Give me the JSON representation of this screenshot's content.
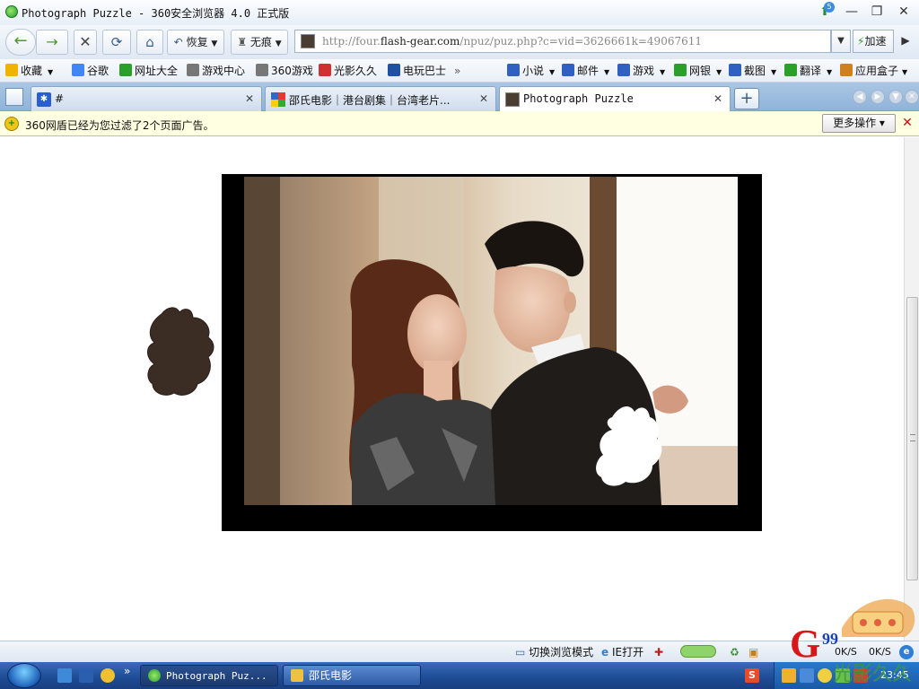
{
  "window": {
    "title": "Photograph Puzzle - 360安全浏览器 4.0 正式版",
    "upgrade_badge": "5",
    "minimize_symbol": "—",
    "maximize_symbol": "❐",
    "close_symbol": "✕"
  },
  "nav": {
    "back_symbol": "←",
    "forward_symbol": "→",
    "stop_symbol": "✕",
    "refresh_symbol": "⟳",
    "home_symbol": "⌂",
    "restore_label": "恢复",
    "private_label": "无痕",
    "url_prefix": "http://four.",
    "url_host": "flash-gear.com",
    "url_path": "/npuz/puz.php?c=vid=3626661k=49067611",
    "addr_dropdown_symbol": "▼",
    "speedup_label": "加速",
    "go_symbol": "▶"
  },
  "bookmarks": {
    "items": [
      {
        "label": "收藏",
        "color": "#f0b400"
      },
      {
        "label": "谷歌",
        "color": "#4285f4"
      },
      {
        "label": "网址大全",
        "color": "#2aa02a"
      },
      {
        "label": "游戏中心",
        "color": "#777777"
      },
      {
        "label": "360游戏",
        "color": "#777777"
      },
      {
        "label": "光影久久",
        "color": "#d03030"
      },
      {
        "label": "电玩巴士",
        "color": "#2050a0"
      }
    ],
    "overflow_symbol": "»",
    "right_items": [
      {
        "label": "小说",
        "color": "#3060c0"
      },
      {
        "label": "邮件",
        "color": "#3060c0"
      },
      {
        "label": "游戏",
        "color": "#3060c0"
      },
      {
        "label": "网银",
        "color": "#2aa02a"
      },
      {
        "label": "截图",
        "color": "#3060c0"
      },
      {
        "label": "翻译",
        "color": "#2aa02a"
      },
      {
        "label": "应用盒子",
        "color": "#d08020"
      }
    ]
  },
  "tabs": [
    {
      "label": "#",
      "close": "✕",
      "active": false
    },
    {
      "label": "邵氏电影｜港台剧集｜台湾老片...",
      "close": "✕",
      "active": false
    },
    {
      "label": "Photograph Puzzle",
      "close": "✕",
      "active": true
    }
  ],
  "tabbar": {
    "new_tab_symbol": "+"
  },
  "notice": {
    "icon_symbol": "+",
    "text": "360网盾已经为您过滤了2个页面广告。",
    "more_label": "更多操作 ▾",
    "close_symbol": "✕"
  },
  "statusbar": {
    "switch_mode_label": "切换浏览模式",
    "ie_open_label": "IE打开",
    "speed_down": "0K/S",
    "speed_up": "0K/S"
  },
  "taskbar": {
    "tasks": [
      {
        "label": "Photograph Puz...",
        "active": true
      },
      {
        "label": "邵氏电影",
        "active": false
      }
    ],
    "overflow_symbol": "»",
    "clock": "23:45"
  },
  "watermark": {
    "logo_text": "G",
    "logo_number": "99",
    "caption": "光影久久"
  },
  "colors": {
    "accent_green": "#4b9a2c",
    "notice_bg": "#ffffe1",
    "tab_bar": "#8fb3d9",
    "taskbar": "#1e4b94"
  }
}
